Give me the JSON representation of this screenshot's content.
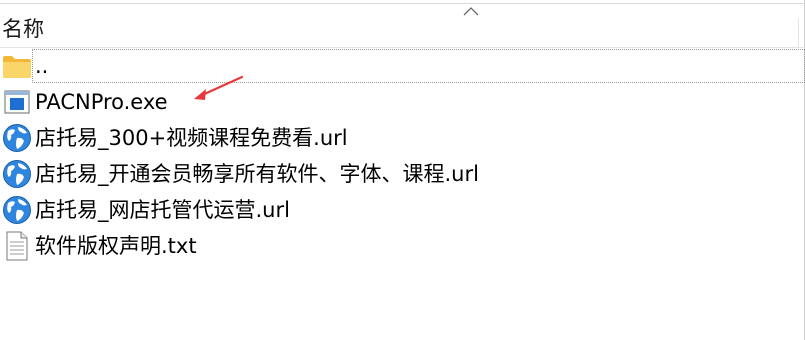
{
  "header": {
    "name_column_label": "名称",
    "sort_icon": "chevron-up-icon"
  },
  "files": [
    {
      "label": "..",
      "icon": "folder-icon"
    },
    {
      "label": "PACNPro.exe",
      "icon": "exe-icon"
    },
    {
      "label": "店托易_300+视频课程免费看.url",
      "icon": "globe-icon"
    },
    {
      "label": "店托易_开通会员畅享所有软件、字体、课程.url",
      "icon": "globe-icon"
    },
    {
      "label": "店托易_网店托管代运营.url",
      "icon": "globe-icon"
    },
    {
      "label": "软件版权声明.txt",
      "icon": "text-file-icon"
    }
  ],
  "annotation": {
    "icon": "red-arrow-icon",
    "color": "#e8383d"
  },
  "colors": {
    "folder": "#f7c948",
    "globe": "#2f7fd6",
    "annotation": "#e8383d"
  }
}
